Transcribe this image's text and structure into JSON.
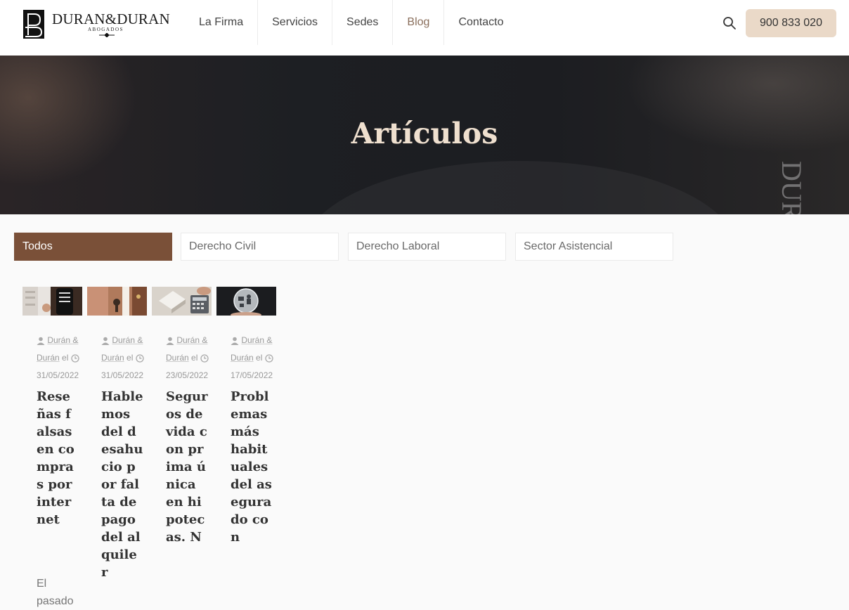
{
  "brand": {
    "name": "DURAN&DURAN",
    "subtitle": "ABOGADOS"
  },
  "nav": {
    "items": [
      {
        "label": "La Firma",
        "active": false
      },
      {
        "label": "Servicios",
        "active": false
      },
      {
        "label": "Sedes",
        "active": false
      },
      {
        "label": "Blog",
        "active": true
      },
      {
        "label": "Contacto",
        "active": false
      }
    ],
    "phone": "900 833 020"
  },
  "hero": {
    "title": "Artículos",
    "spine_text": "DURAN"
  },
  "filters": [
    "Todos",
    "Derecho Civil",
    "Derecho Laboral",
    "Sector Asistencial"
  ],
  "posts": [
    {
      "author_a": "Durán &",
      "author_b": "Durán",
      "prep": "el",
      "date": "31/05/2022",
      "title": "Reseñas falsas en compras por internet",
      "excerpt": "El pasado"
    },
    {
      "author_a": "Durán &",
      "author_b": "Durán",
      "prep": "el",
      "date": "31/05/2022",
      "title": "Hablemos del desahucio por falta de pago del alquiler",
      "excerpt": ""
    },
    {
      "author_a": "Durán &",
      "author_b": "Durán",
      "prep": "el",
      "date": "23/05/2022",
      "title": "Seguros de vida con prima única en hipotecas. N",
      "excerpt": ""
    },
    {
      "author_a": "Durán &",
      "author_b": "Durán",
      "prep": "el",
      "date": "17/05/2022",
      "title": "Problemas más habituales del asegurado con",
      "excerpt": ""
    }
  ],
  "colors": {
    "accent_brown": "#7a5038",
    "phone_bg": "#ead9c8",
    "hero_title": "#efe0cf"
  }
}
